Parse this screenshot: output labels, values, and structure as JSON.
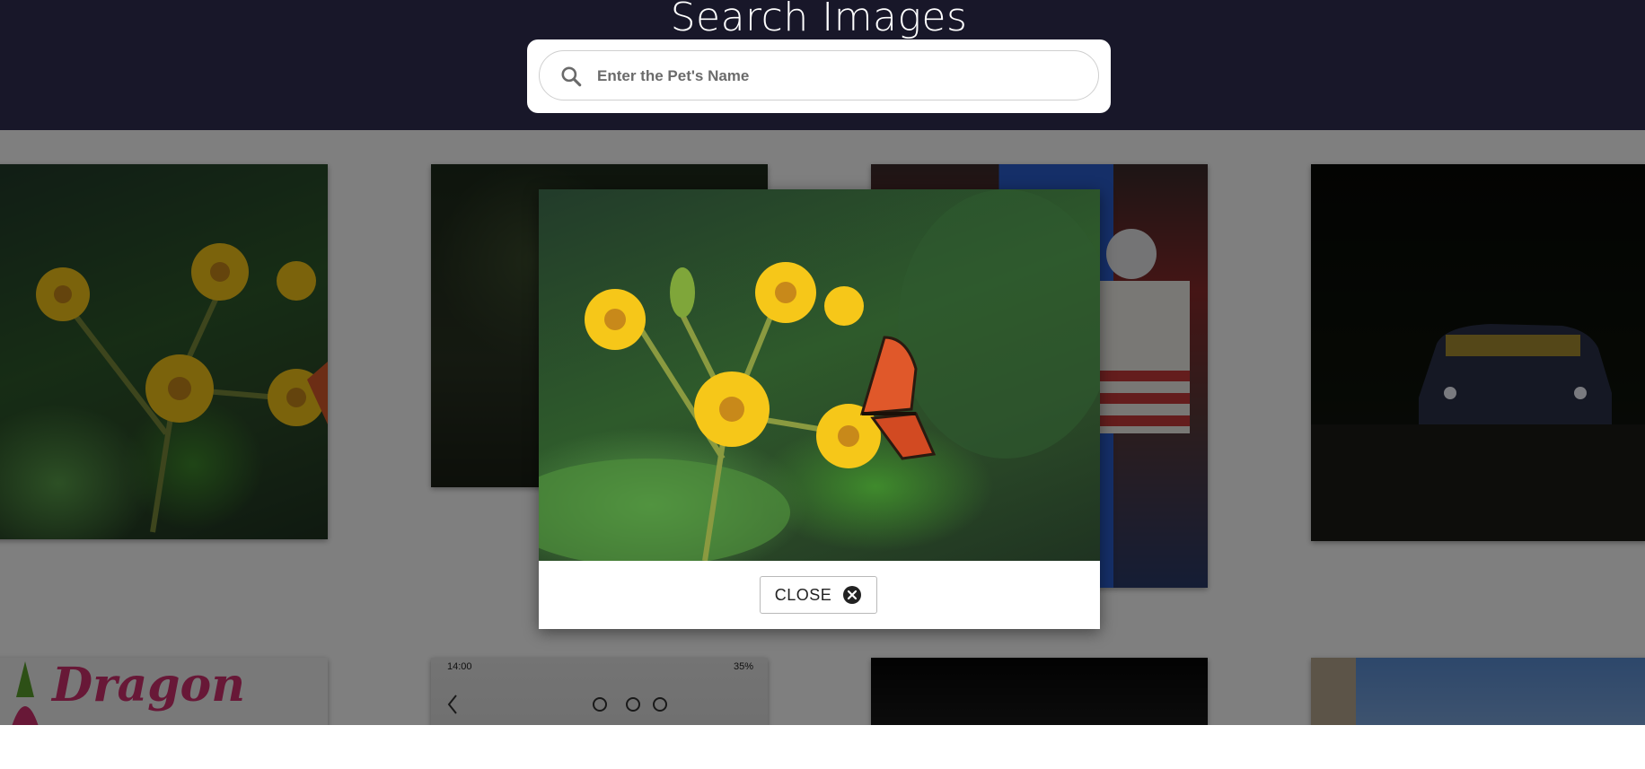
{
  "header": {
    "title": "Search Images",
    "search": {
      "placeholder": "Enter the Pet's Name",
      "value": ""
    }
  },
  "gallery": {
    "row1": [
      {
        "name": "yellow-flowers-butterfly"
      },
      {
        "name": "dark-leaves-berries"
      },
      {
        "name": "hockey-goalie"
      },
      {
        "name": "race-car-night"
      }
    ],
    "row2": [
      {
        "name": "dragon-fruit-graphic",
        "text": "Dragon"
      },
      {
        "name": "phone-screenshot",
        "time": "14:00",
        "status": "35%"
      },
      {
        "name": "dark-hallway"
      },
      {
        "name": "sky-building"
      }
    ]
  },
  "modal": {
    "image_alt": "Yellow flowers with an orange butterfly",
    "close_label": "CLOSE"
  },
  "colors": {
    "header_bg": "#181729",
    "overlay": "rgba(0,0,0,0.5)",
    "flower_yellow": "#f6c719",
    "butterfly_orange": "#e0582a"
  }
}
